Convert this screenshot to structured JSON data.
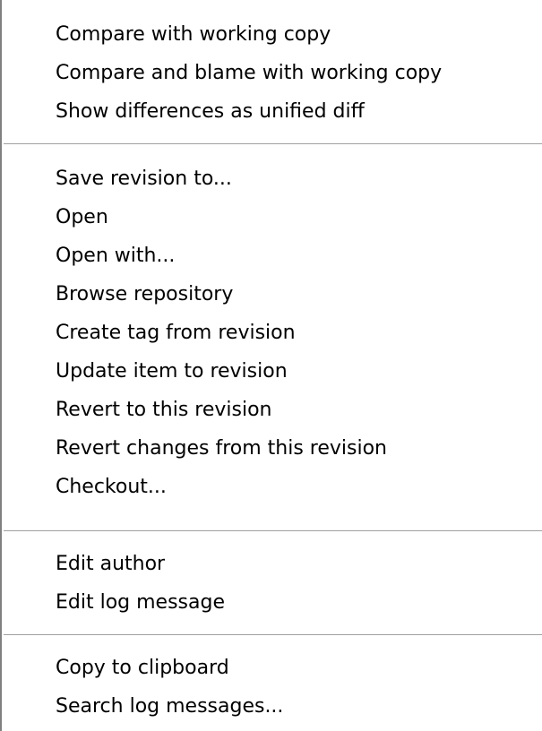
{
  "menu": {
    "items": [
      "Compare with working copy",
      "Compare and blame with working copy",
      "Show differences as unified diff",
      "Save revision to...",
      "Open",
      "Open with...",
      "Browse repository",
      "Create tag from revision",
      "Update item to revision",
      "Revert to this revision",
      "Revert changes from this revision",
      "Checkout...",
      "Edit author",
      "Edit log message",
      "Copy to clipboard",
      "Search log messages..."
    ]
  }
}
